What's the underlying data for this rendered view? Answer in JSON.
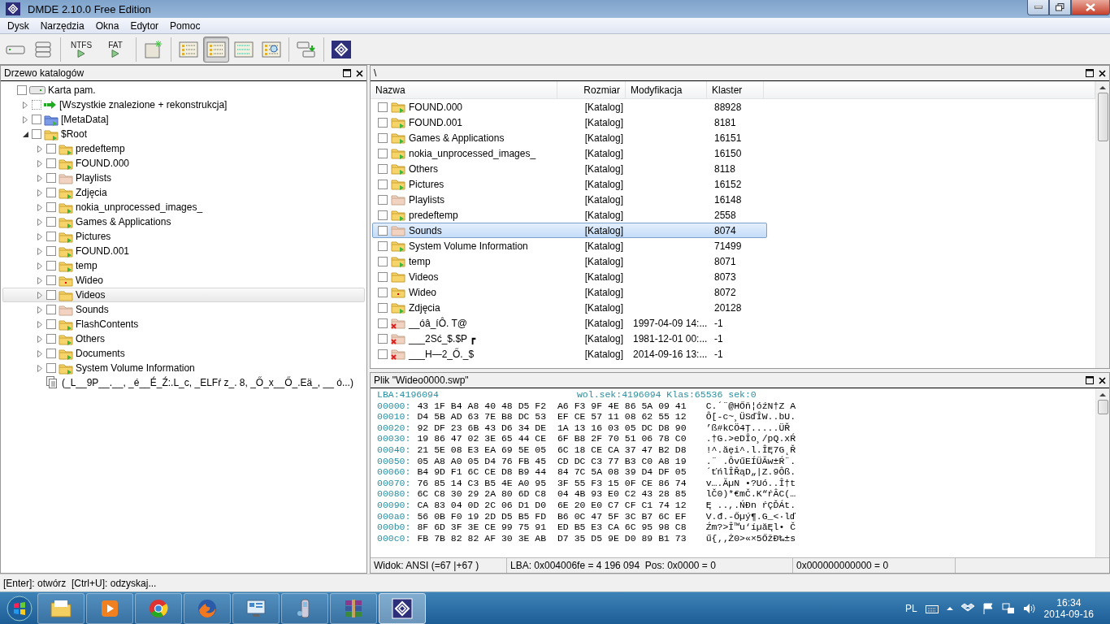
{
  "window": {
    "title": "DMDE 2.10.0 Free Edition"
  },
  "menu": [
    "Dysk",
    "Narzędzia",
    "Okna",
    "Edytor",
    "Pomoc"
  ],
  "toolbar": [
    {
      "kind": "drive",
      "selected": false
    },
    {
      "kind": "drives",
      "selected": false
    },
    {
      "kind": "play",
      "label": "NTFS",
      "selected": false
    },
    {
      "kind": "play",
      "label": "FAT",
      "selected": false
    },
    {
      "kind": "new",
      "selected": false
    },
    {
      "kind": "tree",
      "selected": false
    },
    {
      "kind": "tree-list",
      "selected": true
    },
    {
      "kind": "list",
      "selected": false
    },
    {
      "kind": "tree-search",
      "selected": false
    },
    {
      "kind": "copy",
      "selected": false
    },
    {
      "kind": "logo",
      "selected": false
    }
  ],
  "tree": {
    "title": "Drzewo katalogów",
    "items": [
      {
        "label": "Karta pam.",
        "kind": "drive",
        "checked": false,
        "selected": false,
        "children": [
          {
            "label": "[Wszystkie znalezione + rekonstrukcja]",
            "kind": "arrow",
            "expanded": false,
            "checked": false,
            "selected": false
          },
          {
            "label": "[MetaData]",
            "kind": "meta",
            "expanded": false,
            "checked": false,
            "selected": false
          },
          {
            "label": "$Root",
            "kind": "folder-arrow",
            "expanded": true,
            "checked": false,
            "selected": false,
            "children": [
              {
                "label": "predeftemp",
                "kind": "folder-arrow",
                "expanded": false,
                "checked": false,
                "selected": false
              },
              {
                "label": "FOUND.000",
                "kind": "folder-arrow",
                "expanded": false,
                "checked": false,
                "selected": false
              },
              {
                "label": "Playlists",
                "kind": "folder-empty",
                "expanded": false,
                "checked": false,
                "selected": false
              },
              {
                "label": "Zdjęcia",
                "kind": "folder-arrow",
                "expanded": false,
                "checked": false,
                "selected": false
              },
              {
                "label": "nokia_unprocessed_images_",
                "kind": "folder-arrow",
                "expanded": false,
                "checked": false,
                "selected": false
              },
              {
                "label": "Games & Applications",
                "kind": "folder-arrow",
                "expanded": false,
                "checked": false,
                "selected": false
              },
              {
                "label": "Pictures",
                "kind": "folder-arrow",
                "expanded": false,
                "checked": false,
                "selected": false
              },
              {
                "label": "FOUND.001",
                "kind": "folder-arrow",
                "expanded": false,
                "checked": false,
                "selected": false
              },
              {
                "label": "temp",
                "kind": "folder-arrow",
                "expanded": false,
                "checked": false,
                "selected": false
              },
              {
                "label": "Wideo",
                "kind": "folder-dot",
                "expanded": false,
                "checked": false,
                "selected": false
              },
              {
                "label": "Videos",
                "kind": "folder",
                "expanded": false,
                "checked": false,
                "selected": true
              },
              {
                "label": "Sounds",
                "kind": "folder-empty",
                "expanded": false,
                "checked": false,
                "selected": false
              },
              {
                "label": "FlashContents",
                "kind": "folder-arrow",
                "expanded": false,
                "checked": false,
                "selected": false
              },
              {
                "label": "Others",
                "kind": "folder-arrow",
                "expanded": false,
                "checked": false,
                "selected": false
              },
              {
                "label": "Documents",
                "kind": "folder-arrow",
                "expanded": false,
                "checked": false,
                "selected": false
              },
              {
                "label": "System Volume Information",
                "kind": "folder-arrow",
                "expanded": false,
                "checked": false,
                "selected": false
              },
              {
                "label": "(_L__9P__.__, _é__É_Ź:.L_c, _ELFŕ z_. 8, _Ő_x__Ő_.Eä_, __ ó...)",
                "kind": "files",
                "selected": false
              }
            ]
          }
        ]
      }
    ]
  },
  "files": {
    "path": "\\",
    "columns": [
      "Nazwa",
      "Rozmiar",
      "Modyfikacja",
      "Klaster"
    ],
    "rows": [
      {
        "name": "FOUND.000",
        "kind": "folder-arrow",
        "size": "[Katalog]",
        "cluster": "88928",
        "checked": false,
        "selected": false
      },
      {
        "name": "FOUND.001",
        "kind": "folder-arrow",
        "size": "[Katalog]",
        "cluster": "8181",
        "checked": false,
        "selected": false
      },
      {
        "name": "Games & Applications",
        "kind": "folder-arrow",
        "size": "[Katalog]",
        "cluster": "16151",
        "checked": false,
        "selected": false
      },
      {
        "name": "nokia_unprocessed_images_",
        "kind": "folder-arrow",
        "size": "[Katalog]",
        "cluster": "16150",
        "checked": false,
        "selected": false
      },
      {
        "name": "Others",
        "kind": "folder-arrow",
        "size": "[Katalog]",
        "cluster": "8118",
        "checked": false,
        "selected": false
      },
      {
        "name": "Pictures",
        "kind": "folder-arrow",
        "size": "[Katalog]",
        "cluster": "16152",
        "checked": false,
        "selected": false
      },
      {
        "name": "Playlists",
        "kind": "folder-empty",
        "size": "[Katalog]",
        "cluster": "16148",
        "checked": false,
        "selected": false
      },
      {
        "name": "predeftemp",
        "kind": "folder-arrow",
        "size": "[Katalog]",
        "cluster": "2558",
        "checked": false,
        "selected": false
      },
      {
        "name": "Sounds",
        "kind": "folder-empty",
        "size": "[Katalog]",
        "cluster": "8074",
        "checked": false,
        "selected": true
      },
      {
        "name": "System Volume Information",
        "kind": "folder-arrow",
        "size": "[Katalog]",
        "cluster": "71499",
        "checked": false,
        "selected": false
      },
      {
        "name": "temp",
        "kind": "folder-arrow",
        "size": "[Katalog]",
        "cluster": "8071",
        "checked": false,
        "selected": false
      },
      {
        "name": "Videos",
        "kind": "folder",
        "size": "[Katalog]",
        "cluster": "8073",
        "checked": false,
        "selected": false
      },
      {
        "name": "Wideo",
        "kind": "folder-dot",
        "size": "[Katalog]",
        "cluster": "8072",
        "checked": false,
        "selected": false
      },
      {
        "name": "Zdjęcia",
        "kind": "folder-arrow",
        "size": "[Katalog]",
        "cluster": "20128",
        "checked": false,
        "selected": false
      },
      {
        "name": "__óâ_íÔ. T@",
        "kind": "folder-deleted",
        "size": "[Katalog]",
        "modified": "1997-04-09 14:...",
        "cluster": "-1",
        "checked": false,
        "selected": false
      },
      {
        "name": "___2Sć_$.$P ┏",
        "kind": "folder-deleted",
        "size": "[Katalog]",
        "modified": "1981-12-01 00:...",
        "cluster": "-1",
        "checked": false,
        "selected": false
      },
      {
        "name": "___H—2_Ő._$",
        "kind": "folder-deleted",
        "size": "[Katalog]",
        "modified": "2014-09-16 13:...",
        "cluster": "-1",
        "checked": false,
        "selected": false
      }
    ]
  },
  "hex": {
    "title": "Plik \"Wideo0000.swp\"",
    "lba": "LBA:4196094",
    "info": "wol.sek:4196094 Klas:65536 sek:0",
    "rows": [
      {
        "offset": "00000:",
        "bytes": "43 1F B4 A8 40 48 D5 F2  A6 F3 9F 4E 86 5A 09 41",
        "text": "C.´¨@HŐň¦óźN†Z A"
      },
      {
        "offset": "00010:",
        "bytes": "D4 5B AD 63 7E B8 DC 53  EF CE 57 11 08 62 55 12",
        "text": "Ô[-c~¸ÜSďÎW..bU."
      },
      {
        "offset": "00020:",
        "bytes": "92 DF 23 6B 43 D6 34 DE  1A 13 16 03 05 DC D8 90",
        "text": "’ß#kCÖ4Ţ.....ÜŘ"
      },
      {
        "offset": "00030:",
        "bytes": "19 86 47 02 3E 65 44 CE  6F B8 2F 70 51 06 78 C0",
        "text": ".†G.>eDÎo¸/pQ.xŔ"
      },
      {
        "offset": "00040:",
        "bytes": "21 5E 08 E3 EA 69 5E 05  6C 18 CE CA 37 47 B2 D8",
        "text": "!^.ăęi^.l.ÎĘ7G˛Ř"
      },
      {
        "offset": "00050:",
        "bytes": "05 A8 A0 05 D4 76 FB 45  CD DC C3 77 B3 C0 A8 19",
        "text": ".¨ .ÔvűEÍÜĂw±Ŕ¨."
      },
      {
        "offset": "00060:",
        "bytes": "B4 9D F1 6C CE D8 B9 44  84 7C 5A 08 39 D4 DF 05",
        "text": "´ťńlÎŘąD„|Z.9Ôß."
      },
      {
        "offset": "00070:",
        "bytes": "76 85 14 C3 B5 4E A0 95  3F 55 F3 15 0F CE 86 74",
        "text": "v….ĂµN •?Uó..Î†t"
      },
      {
        "offset": "00080:",
        "bytes": "6C C8 30 29 2A 80 6D C8  04 4B 93 E0 C2 43 28 85",
        "text": "lČ0)*€mČ.K“ŕÂC(…"
      },
      {
        "offset": "00090:",
        "bytes": "CA 83 04 0D 2C 06 D1 D0  6E 20 E0 C7 CF C1 74 12",
        "text": "Ę ..,.ŃĐn ŕÇĎÁt."
      },
      {
        "offset": "000a0:",
        "bytes": "56 0B F0 19 2D D5 B5 FD  B6 0C 47 5F 3C B7 6C EF",
        "text": "V.đ.-Őµý¶.G_<·lď"
      },
      {
        "offset": "000b0:",
        "bytes": "8F 6D 3F 3E CE 99 75 91  ED B5 E3 CA 6C 95 98 C8",
        "text": "Źm?>Î™u‘íµăĘl• Č"
      },
      {
        "offset": "000c0:",
        "bytes": "FB 7B 82 82 AF 30 3E AB  D7 35 D5 9E D0 89 B1 73",
        "text": "ű{‚‚Ż0>«×5ŐžĐ‰±s"
      }
    ],
    "status": [
      "Widok: ANSI (=67 |+67 )",
      "LBA: 0x004006fe = 4 196 094  Pos: 0x0000 = 0",
      "0x000000000000 = 0"
    ]
  },
  "status_bar": "[Enter]: otwórz  [Ctrl+U]: odzyskaj...",
  "taskbar": {
    "apps": [
      {
        "kind": "folder",
        "active": false
      },
      {
        "kind": "media",
        "active": false
      },
      {
        "kind": "chrome",
        "active": false
      },
      {
        "kind": "firefox",
        "active": false
      },
      {
        "kind": "panel",
        "active": false
      },
      {
        "kind": "phone",
        "active": false
      },
      {
        "kind": "archive",
        "active": false
      },
      {
        "kind": "dmde",
        "active": true
      }
    ],
    "language": "PL",
    "time": "16:34",
    "date": "2014-09-16"
  }
}
